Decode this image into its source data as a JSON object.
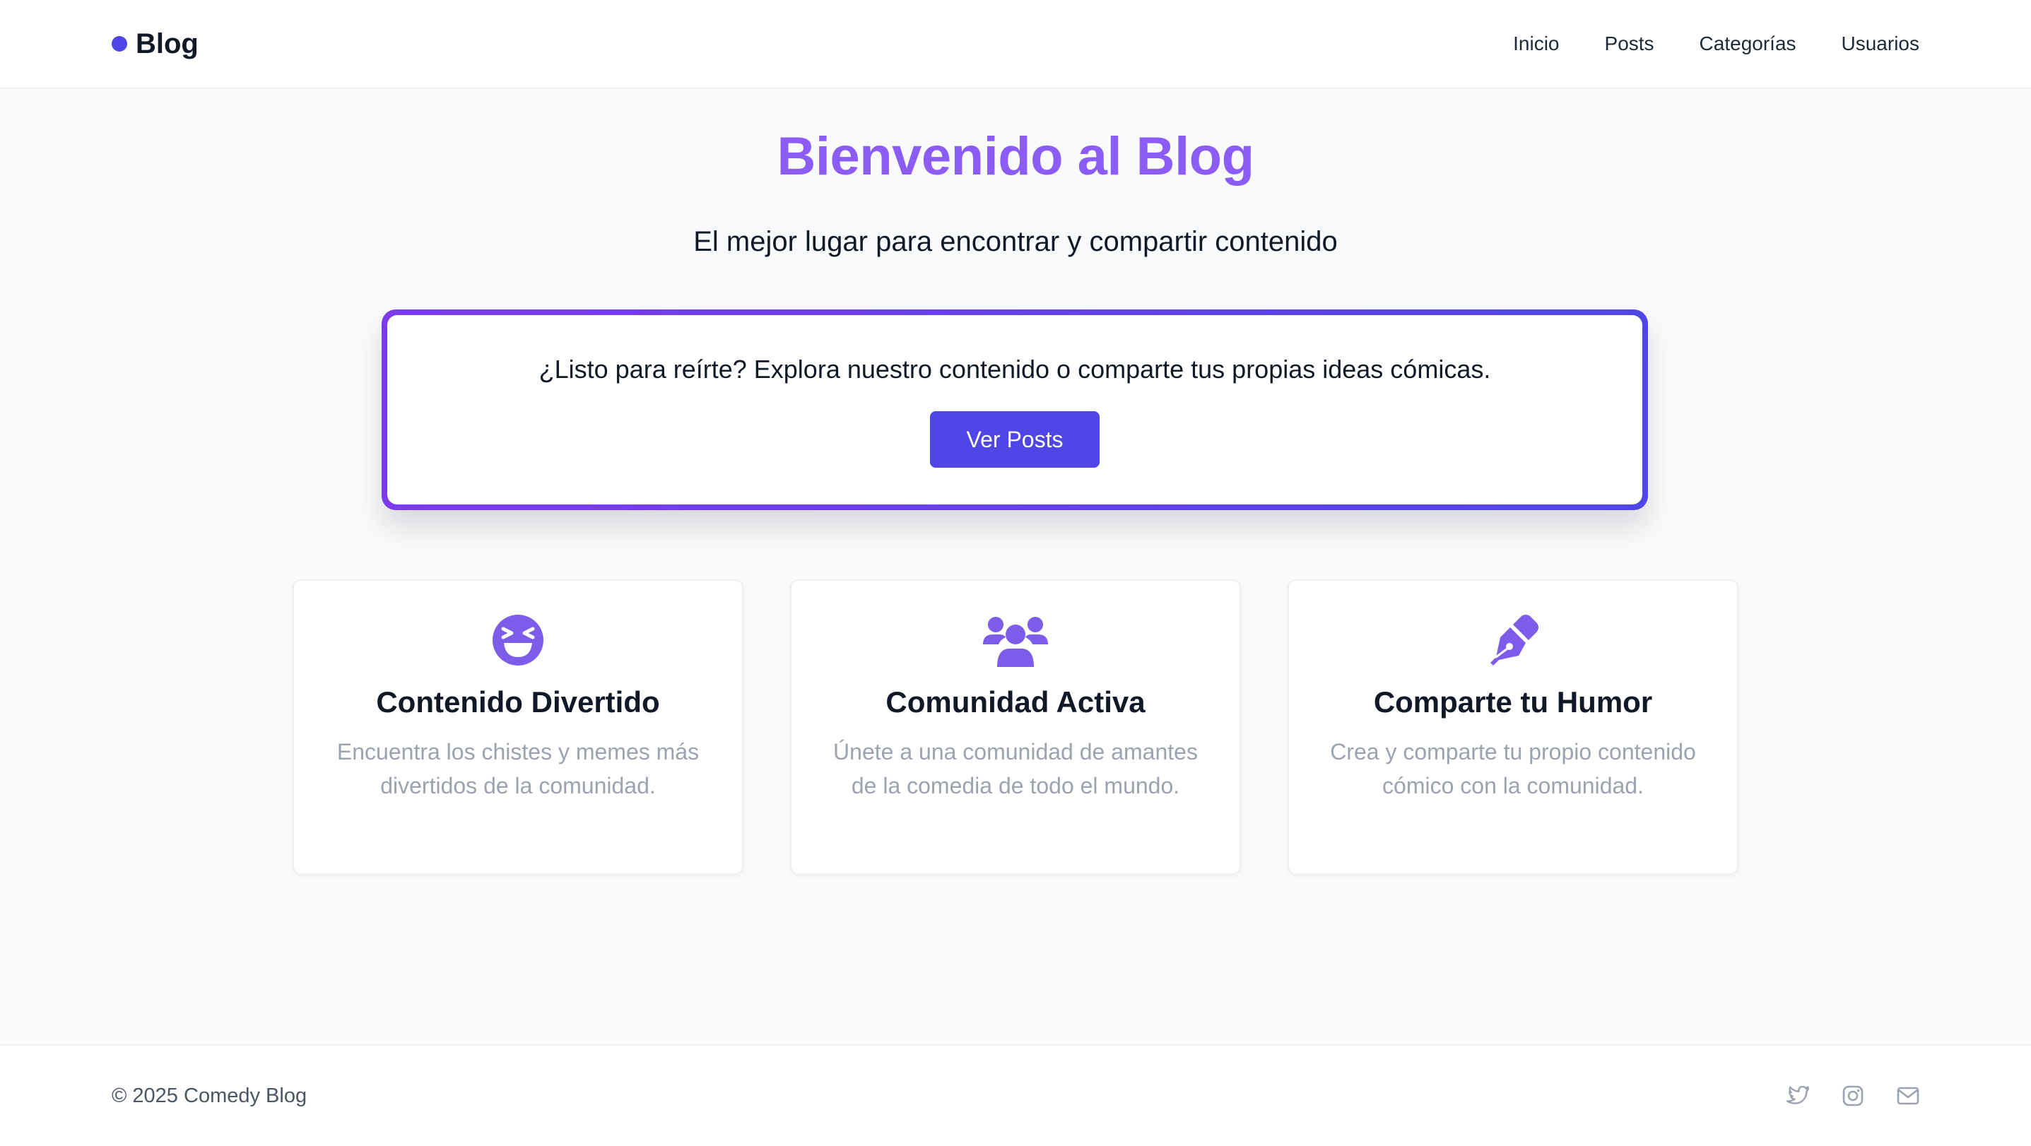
{
  "header": {
    "brand": "Blog",
    "nav": [
      "Inicio",
      "Posts",
      "Categorías",
      "Usuarios"
    ]
  },
  "hero": {
    "title": "Bienvenido al Blog",
    "subtitle": "El mejor lugar para encontrar y compartir contenido"
  },
  "cta": {
    "text": "¿Listo para reírte? Explora nuestro contenido o comparte tus propias ideas cómicas.",
    "button": "Ver Posts"
  },
  "features": [
    {
      "icon": "laughing-face-icon",
      "title": "Contenido Divertido",
      "description": "Encuentra los chistes y memes más divertidos de la comunidad."
    },
    {
      "icon": "users-group-icon",
      "title": "Comunidad Activa",
      "description": "Únete a una comunidad de amantes de la comedia de todo el mundo."
    },
    {
      "icon": "pen-nib-icon",
      "title": "Comparte tu Humor",
      "description": "Crea y comparte tu propio contenido cómico con la comunidad."
    }
  ],
  "footer": {
    "copyright": "© 2025 Comedy Blog",
    "social_icons": [
      "twitter-icon",
      "instagram-icon",
      "email-icon"
    ]
  },
  "colors": {
    "accent": "#4f46e5",
    "title_purple": "#8b5cf6",
    "icon_purple": "#7c5ce8",
    "muted_text": "#9ca3af"
  }
}
